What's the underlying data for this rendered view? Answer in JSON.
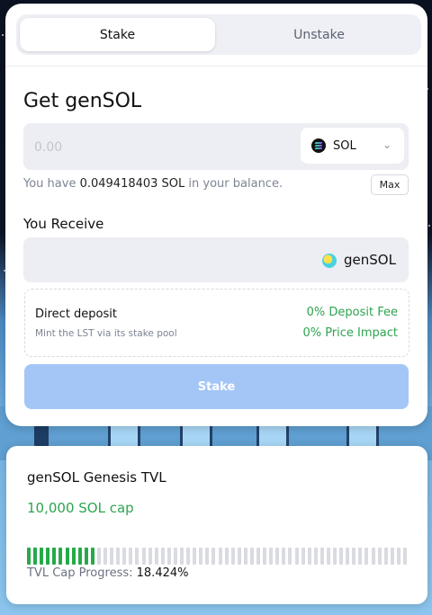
{
  "tabs": {
    "stake_label": "Stake",
    "unstake_label": "Unstake",
    "active": "Stake"
  },
  "form": {
    "title": "Get genSOL",
    "amount": {
      "value": "",
      "placeholder": "0.00"
    },
    "token": {
      "label": "SOL",
      "icon": "solana-icon"
    },
    "balance": {
      "prefix": "You have",
      "amount": "0.049418403 SOL",
      "suffix": "in your balance."
    },
    "max_label": "Max",
    "receive_label": "You Receive",
    "receive_token": {
      "label": "genSOL",
      "icon": "gensol-icon"
    },
    "deposit": {
      "title": "Direct deposit",
      "subtitle": "Mint the LST via its stake pool",
      "fee": "0% Deposit Fee",
      "impact": "0% Price Impact"
    },
    "submit_label": "Stake"
  },
  "tvl": {
    "title": "genSOL Genesis TVL",
    "cap": "10,000 SOL cap",
    "progress_label": "TVL Cap Progress:",
    "progress_value": "18.424%",
    "progress_fraction": 0.18424,
    "segments_total": 60
  },
  "colors": {
    "accent_green": "#2ea44f",
    "button_disabled": "#a4c6f7",
    "progress_filled": "#27a94a",
    "progress_empty": "#d9dbe0"
  }
}
